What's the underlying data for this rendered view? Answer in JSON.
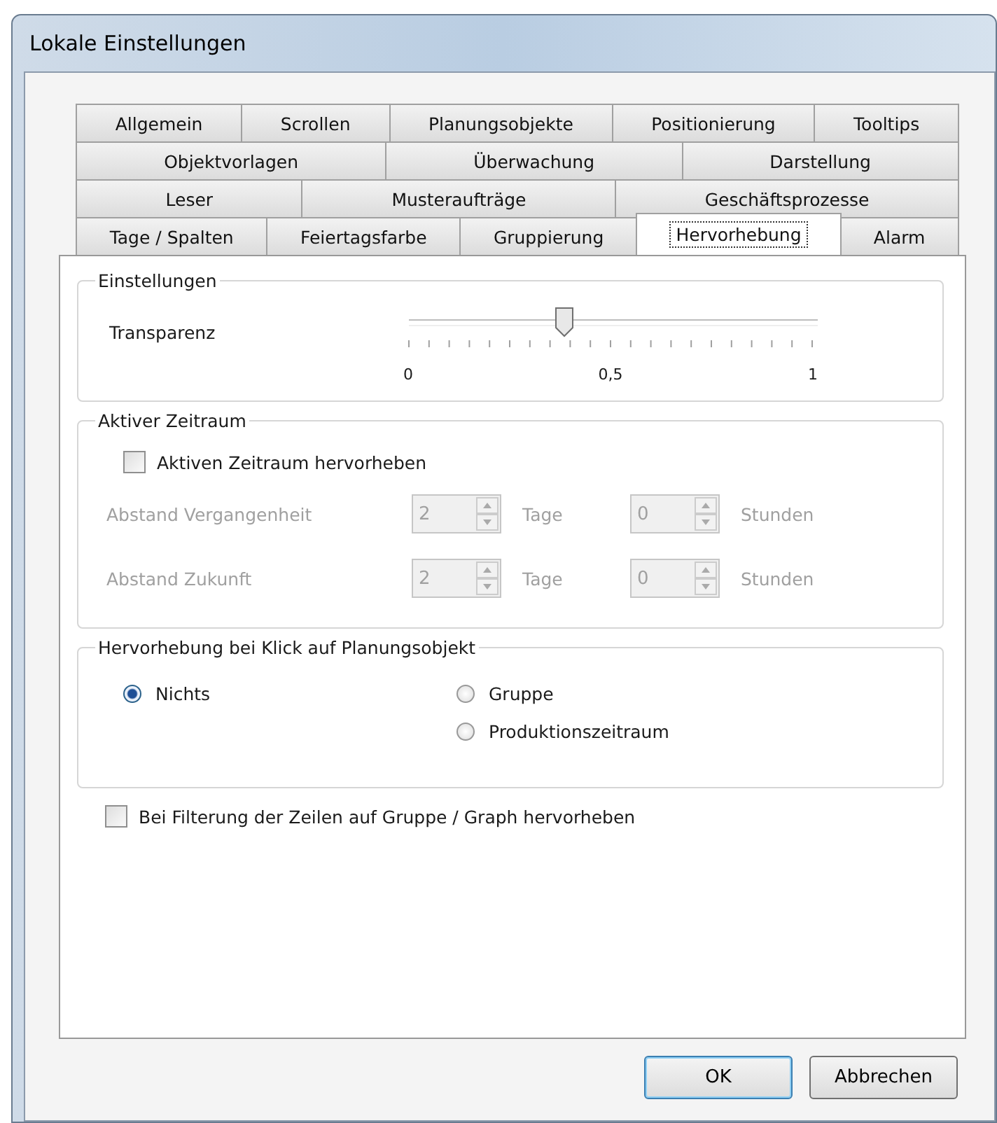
{
  "window": {
    "title": "Lokale Einstellungen"
  },
  "tab_rows": [
    [
      {
        "label": "Allgemein",
        "selected": false
      },
      {
        "label": "Scrollen",
        "selected": false
      },
      {
        "label": "Planungsobjekte",
        "selected": false
      },
      {
        "label": "Positionierung",
        "selected": false
      },
      {
        "label": "Tooltips",
        "selected": false
      }
    ],
    [
      {
        "label": "Objektvorlagen",
        "selected": false
      },
      {
        "label": "Überwachung",
        "selected": false
      },
      {
        "label": "Darstellung",
        "selected": false
      }
    ],
    [
      {
        "label": "Leser",
        "selected": false
      },
      {
        "label": "Musteraufträge",
        "selected": false
      },
      {
        "label": "Geschäftsprozesse",
        "selected": false
      }
    ],
    [
      {
        "label": "Tage / Spalten",
        "selected": false
      },
      {
        "label": "Feiertagsfarbe",
        "selected": false
      },
      {
        "label": "Gruppierung",
        "selected": false
      },
      {
        "label": "Hervorhebung",
        "selected": true
      },
      {
        "label": "Alarm",
        "selected": false
      }
    ]
  ],
  "einstellungen": {
    "title": "Einstellungen",
    "slider": {
      "label": "Transparenz",
      "level": 0.38,
      "scale": [
        "0",
        "0,5",
        "1"
      ]
    }
  },
  "aktiver_zeitraum": {
    "title": "Aktiver Zeitraum",
    "checkbox": {
      "label": "Aktiven Zeitraum hervorheben",
      "checked": false
    },
    "rows": [
      {
        "label": "Abstand Vergangenheit",
        "disabled": true,
        "days": "2",
        "days_unit": "Tage",
        "hours": "0",
        "hours_unit": "Stunden"
      },
      {
        "label": "Abstand Zukunft",
        "disabled": true,
        "days": "2",
        "days_unit": "Tage",
        "hours": "0",
        "hours_unit": "Stunden"
      }
    ]
  },
  "hervorhebung": {
    "title": "Hervorhebung bei Klick auf Planungsobjekt",
    "options": [
      {
        "label": "Nichts",
        "selected": true
      },
      {
        "label": "Gruppe",
        "selected": false
      },
      {
        "label": "Produktionszeitraum",
        "selected": false
      }
    ]
  },
  "filter_checkbox": {
    "label": "Bei Filterung der Zeilen auf Gruppe / Graph hervorheben",
    "checked": false
  },
  "buttons": [
    {
      "label": "OK",
      "default": true
    },
    {
      "label": "Abbrechen",
      "default": false
    }
  ]
}
